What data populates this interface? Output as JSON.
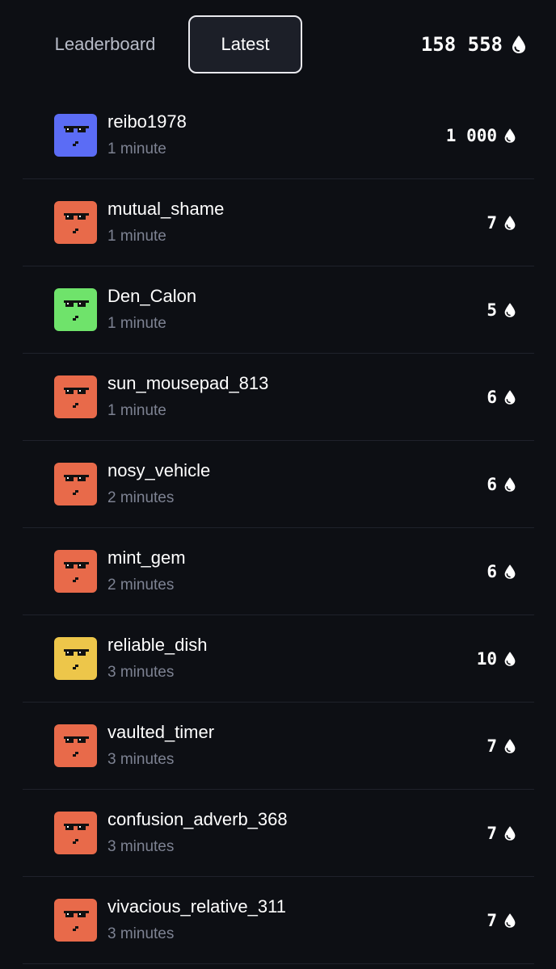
{
  "tabs": {
    "leaderboard_label": "Leaderboard",
    "latest_label": "Latest",
    "active": "Latest"
  },
  "balance": {
    "value": "158 558",
    "icon": "drop-icon"
  },
  "colors": {
    "background": "#0d0f14",
    "blue": "#5b6cf5",
    "orange": "#e86a4a",
    "green": "#6fe36b",
    "yellow": "#edc64a"
  },
  "entries": [
    {
      "name": "reibo1978",
      "time": "1 minute",
      "amount": "1 000",
      "avatar_color": "#5b6cf5"
    },
    {
      "name": "mutual_shame",
      "time": "1 minute",
      "amount": "7",
      "avatar_color": "#e86a4a"
    },
    {
      "name": "Den_Calon",
      "time": "1 minute",
      "amount": "5",
      "avatar_color": "#6fe36b"
    },
    {
      "name": "sun_mousepad_813",
      "time": "1 minute",
      "amount": "6",
      "avatar_color": "#e86a4a"
    },
    {
      "name": "nosy_vehicle",
      "time": "2 minutes",
      "amount": "6",
      "avatar_color": "#e86a4a"
    },
    {
      "name": "mint_gem",
      "time": "2 minutes",
      "amount": "6",
      "avatar_color": "#e86a4a"
    },
    {
      "name": "reliable_dish",
      "time": "3 minutes",
      "amount": "10",
      "avatar_color": "#edc64a"
    },
    {
      "name": "vaulted_timer",
      "time": "3 minutes",
      "amount": "7",
      "avatar_color": "#e86a4a"
    },
    {
      "name": "confusion_adverb_368",
      "time": "3 minutes",
      "amount": "7",
      "avatar_color": "#e86a4a"
    },
    {
      "name": "vivacious_relative_311",
      "time": "3 minutes",
      "amount": "7",
      "avatar_color": "#e86a4a"
    }
  ]
}
